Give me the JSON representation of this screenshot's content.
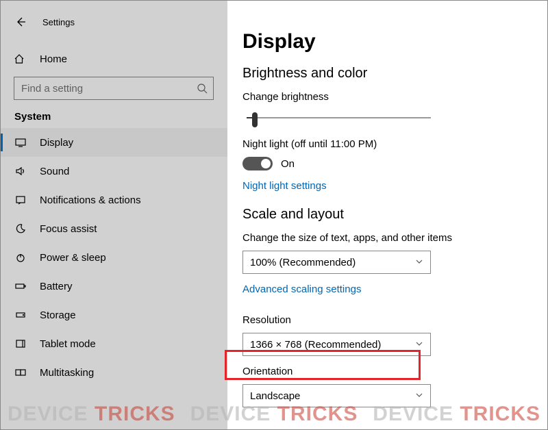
{
  "header": {
    "app_title": "Settings"
  },
  "sidebar": {
    "home_label": "Home",
    "search_placeholder": "Find a setting",
    "category": "System",
    "items": [
      {
        "label": "Display"
      },
      {
        "label": "Sound"
      },
      {
        "label": "Notifications & actions"
      },
      {
        "label": "Focus assist"
      },
      {
        "label": "Power & sleep"
      },
      {
        "label": "Battery"
      },
      {
        "label": "Storage"
      },
      {
        "label": "Tablet mode"
      },
      {
        "label": "Multitasking"
      }
    ]
  },
  "main": {
    "title": "Display",
    "section_brightness": "Brightness and color",
    "brightness_label": "Change brightness",
    "night_light_label": "Night light (off until 11:00 PM)",
    "night_light_state": "On",
    "night_light_link": "Night light settings",
    "section_scale": "Scale and layout",
    "scale_label": "Change the size of text, apps, and other items",
    "scale_value": "100% (Recommended)",
    "scale_link": "Advanced scaling settings",
    "resolution_label": "Resolution",
    "resolution_value": "1366 × 768 (Recommended)",
    "orientation_label": "Orientation",
    "orientation_value": "Landscape"
  },
  "watermark": {
    "text_a": "DEVICE",
    "text_b": "TRICKS"
  }
}
